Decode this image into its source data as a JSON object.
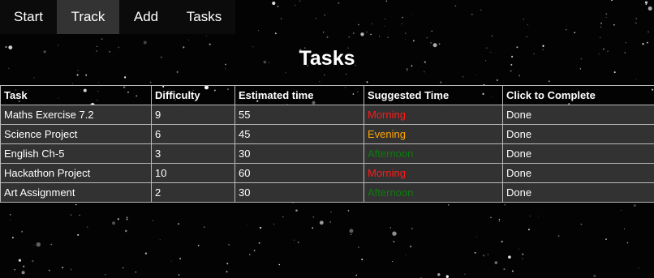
{
  "nav": {
    "items": [
      {
        "label": "Start"
      },
      {
        "label": "Track"
      },
      {
        "label": "Add"
      },
      {
        "label": "Tasks"
      }
    ]
  },
  "page": {
    "title": "Tasks"
  },
  "table": {
    "headers": [
      "Task",
      "Difficulty",
      "Estimated time",
      "Suggested Time",
      "Click to Complete"
    ],
    "rows": [
      {
        "task": "Maths Exercise 7.2",
        "difficulty": "9",
        "time": "55",
        "suggested": "Morning",
        "action": "Done"
      },
      {
        "task": "Science Project",
        "difficulty": "6",
        "time": "45",
        "suggested": "Evening",
        "action": "Done"
      },
      {
        "task": "English Ch-5",
        "difficulty": "3",
        "time": "30",
        "suggested": "Afternoon",
        "action": "Done"
      },
      {
        "task": "Hackathon Project",
        "difficulty": "10",
        "time": "60",
        "suggested": "Morning",
        "action": "Done"
      },
      {
        "task": "Art Assignment",
        "difficulty": "2",
        "time": "30",
        "suggested": "Afternoon",
        "action": "Done"
      }
    ]
  },
  "colors": {
    "Morning": "#ff1a1a",
    "Evening": "#ffa500",
    "Afternoon": "#0f7a0f"
  }
}
